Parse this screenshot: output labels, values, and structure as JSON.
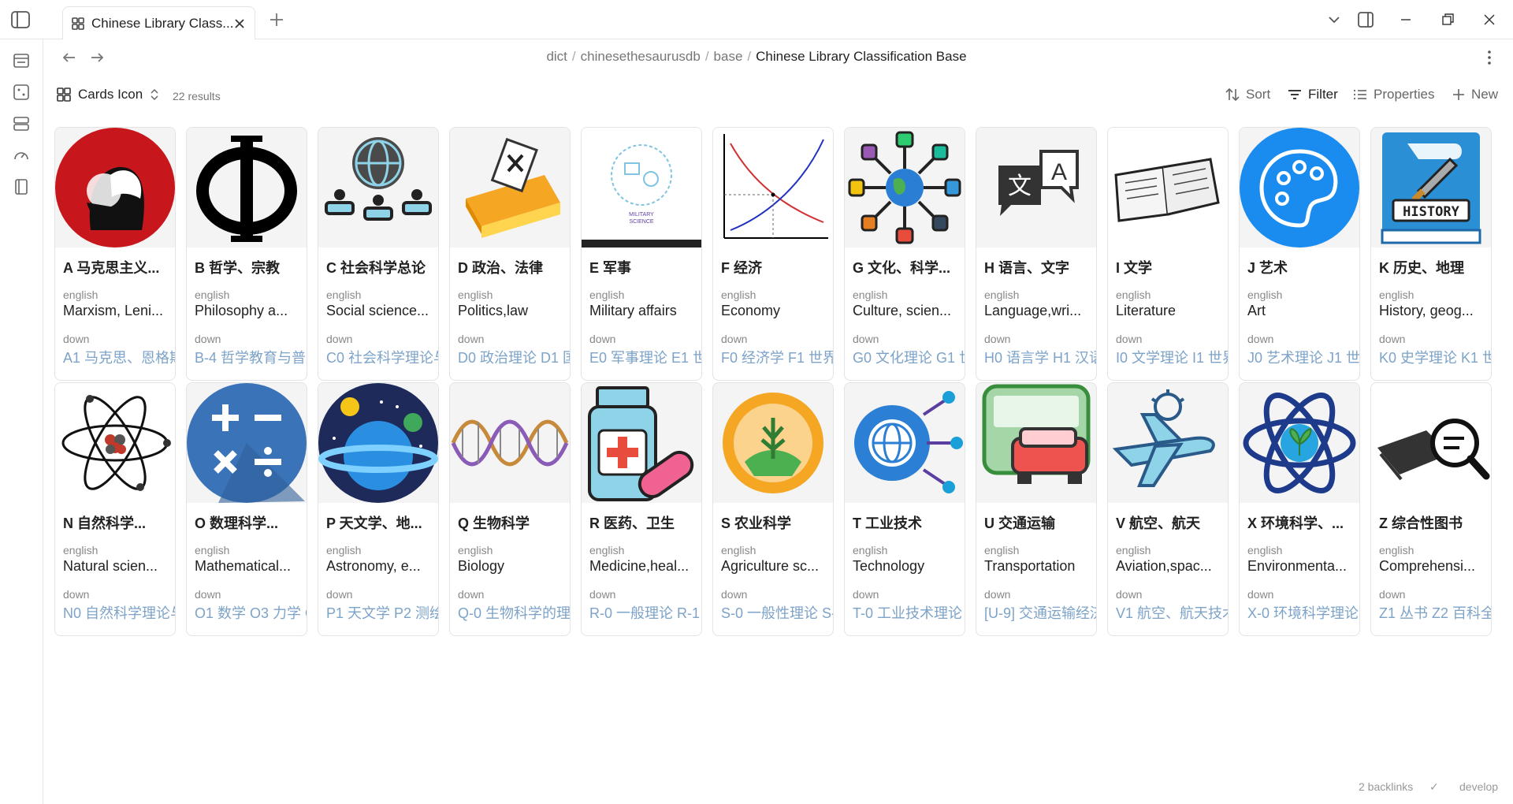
{
  "tab": {
    "title": "Chinese Library Class..."
  },
  "breadcrumb": {
    "p1": "dict",
    "p2": "chinesethesaurusdb",
    "p3": "base",
    "current": "Chinese Library Classification Base",
    "sep": "/"
  },
  "toolbar": {
    "view": "Cards Icon",
    "results": "22 results",
    "sort": "Sort",
    "filter": "Filter",
    "properties": "Properties",
    "new": "New"
  },
  "status": {
    "backlinks": "2 backlinks",
    "branch": "develop"
  },
  "labels": {
    "english": "english",
    "down": "down"
  },
  "cards": [
    {
      "name": "A 马克思主义...",
      "english": "Marxism, Leni...",
      "down": "A1 马克思、恩格斯",
      "icon": "marx-lenin-portrait-icon"
    },
    {
      "name": "B 哲学、宗教",
      "english": "Philosophy a...",
      "down": "B-4 哲学教育与普及",
      "icon": "phi-symbol-icon"
    },
    {
      "name": "C 社会科学总论",
      "english": "Social science...",
      "down": "C0 社会科学理论与",
      "icon": "globe-people-icon"
    },
    {
      "name": "D 政治、法律",
      "english": "Politics,law",
      "down": "D0 政治理论 D1 国",
      "icon": "ballot-box-icon"
    },
    {
      "name": "E 军事",
      "english": "Military affairs",
      "down": "E0 军事理论 E1 世",
      "icon": "military-science-icon"
    },
    {
      "name": "F 经济",
      "english": "Economy",
      "down": "F0 经济学 F1 世界",
      "icon": "supply-demand-chart-icon"
    },
    {
      "name": "G 文化、科学...",
      "english": "Culture, scien...",
      "down": "G0 文化理论 G1 世",
      "icon": "global-network-icon"
    },
    {
      "name": "H 语言、文字",
      "english": "Language,wri...",
      "down": "H0 语言学 H1 汉语",
      "icon": "translate-icon"
    },
    {
      "name": "I 文学",
      "english": "Literature",
      "down": "I0 文学理论 I1 世界",
      "icon": "open-book-icon"
    },
    {
      "name": "J 艺术",
      "english": "Art",
      "down": "J0 艺术理论 J1 世界",
      "icon": "palette-icon"
    },
    {
      "name": "K 历史、地理",
      "english": "History, geog...",
      "down": "K0 史学理论 K1 世",
      "icon": "history-book-icon"
    },
    {
      "name": "N 自然科学...",
      "english": "Natural scien...",
      "down": "N0 自然科学理论与",
      "icon": "atom-icon"
    },
    {
      "name": "O 数理科学...",
      "english": "Mathematical...",
      "down": "O1 数学 O3 力学 O",
      "icon": "math-operators-icon"
    },
    {
      "name": "P 天文学、地...",
      "english": "Astronomy, e...",
      "down": "P1 天文学 P2 测绘",
      "icon": "planet-icon"
    },
    {
      "name": "Q 生物科学",
      "english": "Biology",
      "down": "Q-0 生物科学的理",
      "icon": "dna-icon"
    },
    {
      "name": "R 医药、卫生",
      "english": "Medicine,heal...",
      "down": "R-0 一般理论 R-1",
      "icon": "medicine-bottle-icon"
    },
    {
      "name": "S 农业科学",
      "english": "Agriculture sc...",
      "down": "S-0 一般性理论 S-",
      "icon": "agriculture-icon"
    },
    {
      "name": "T 工业技术",
      "english": "Technology",
      "down": "T-0 工业技术理论",
      "icon": "gear-globe-icon"
    },
    {
      "name": "U 交通运输",
      "english": "Transportation",
      "down": "[U-9] 交通运输经济",
      "icon": "transport-icon"
    },
    {
      "name": "V 航空、航天",
      "english": "Aviation,spac...",
      "down": "V1 航空、航天技术",
      "icon": "airplane-icon"
    },
    {
      "name": "X 环境科学、...",
      "english": "Environmenta...",
      "down": "X-0 环境科学理论",
      "icon": "environment-atom-icon"
    },
    {
      "name": "Z 综合性图书",
      "english": "Comprehensi...",
      "down": "Z1 丛书 Z2 百科全",
      "icon": "book-magnifier-icon"
    }
  ]
}
